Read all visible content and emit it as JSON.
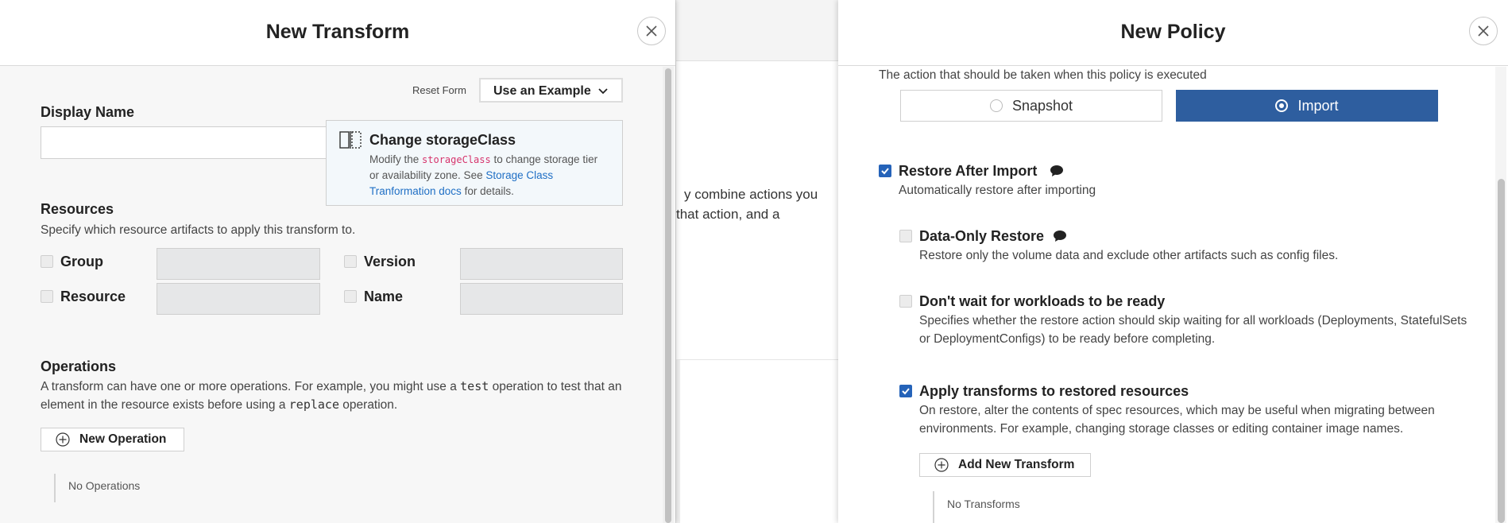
{
  "background": {
    "text_line1": "y combine actions you",
    "text_line2": "that action, and a"
  },
  "left_panel": {
    "title": "New Transform",
    "reset_form": "Reset Form",
    "use_example": "Use an Example",
    "display_name_label": "Display Name",
    "display_name_value": "",
    "tooltip": {
      "title": "Change storageClass",
      "body_before": "Modify the ",
      "code": "storageClass",
      "body_middle": " to change storage tier or availability zone. See ",
      "link": "Storage Class Tranformation docs",
      "body_after": " for details."
    },
    "resources": {
      "label": "Resources",
      "description": "Specify which resource artifacts to apply this transform to.",
      "fields": {
        "group": "Group",
        "version": "Version",
        "resource": "Resource",
        "name": "Name"
      }
    },
    "operations": {
      "label": "Operations",
      "desc_part1": "A transform can have one or more operations. For example, you might use a ",
      "code1": "test",
      "desc_part2": " operation to test that an element in the resource exists before using a ",
      "code2": "replace",
      "desc_part3": " operation.",
      "new_operation": "New Operation",
      "empty": "No Operations"
    }
  },
  "right_panel": {
    "title": "New Policy",
    "action_desc": "The action that should be taken when this policy is executed",
    "actions": [
      {
        "label": "Snapshot",
        "selected": false
      },
      {
        "label": "Import",
        "selected": true
      }
    ],
    "restore_after_import": {
      "label": "Restore After Import",
      "desc": "Automatically restore after importing",
      "checked": true
    },
    "data_only_restore": {
      "label": "Data-Only Restore",
      "desc": "Restore only the volume data and exclude other artifacts such as config files.",
      "checked": false
    },
    "dont_wait": {
      "label": "Don't wait for workloads to be ready",
      "desc": "Specifies whether the restore action should skip waiting for all workloads (Deployments, StatefulSets or DeploymentConfigs) to be ready before completing.",
      "checked": false
    },
    "apply_transforms": {
      "label": "Apply transforms to restored resources",
      "desc": "On restore, alter the contents of spec resources, which may be useful when migrating between environments. For example, changing storage classes or editing container image names.",
      "checked": true
    },
    "add_new_transform": "Add New Transform",
    "empty": "No Transforms"
  },
  "colors": {
    "accent": "#2e5e9f",
    "checkbox_checked": "#2563b9",
    "link": "#1f6fc5",
    "code_highlight": "#d6336c"
  }
}
